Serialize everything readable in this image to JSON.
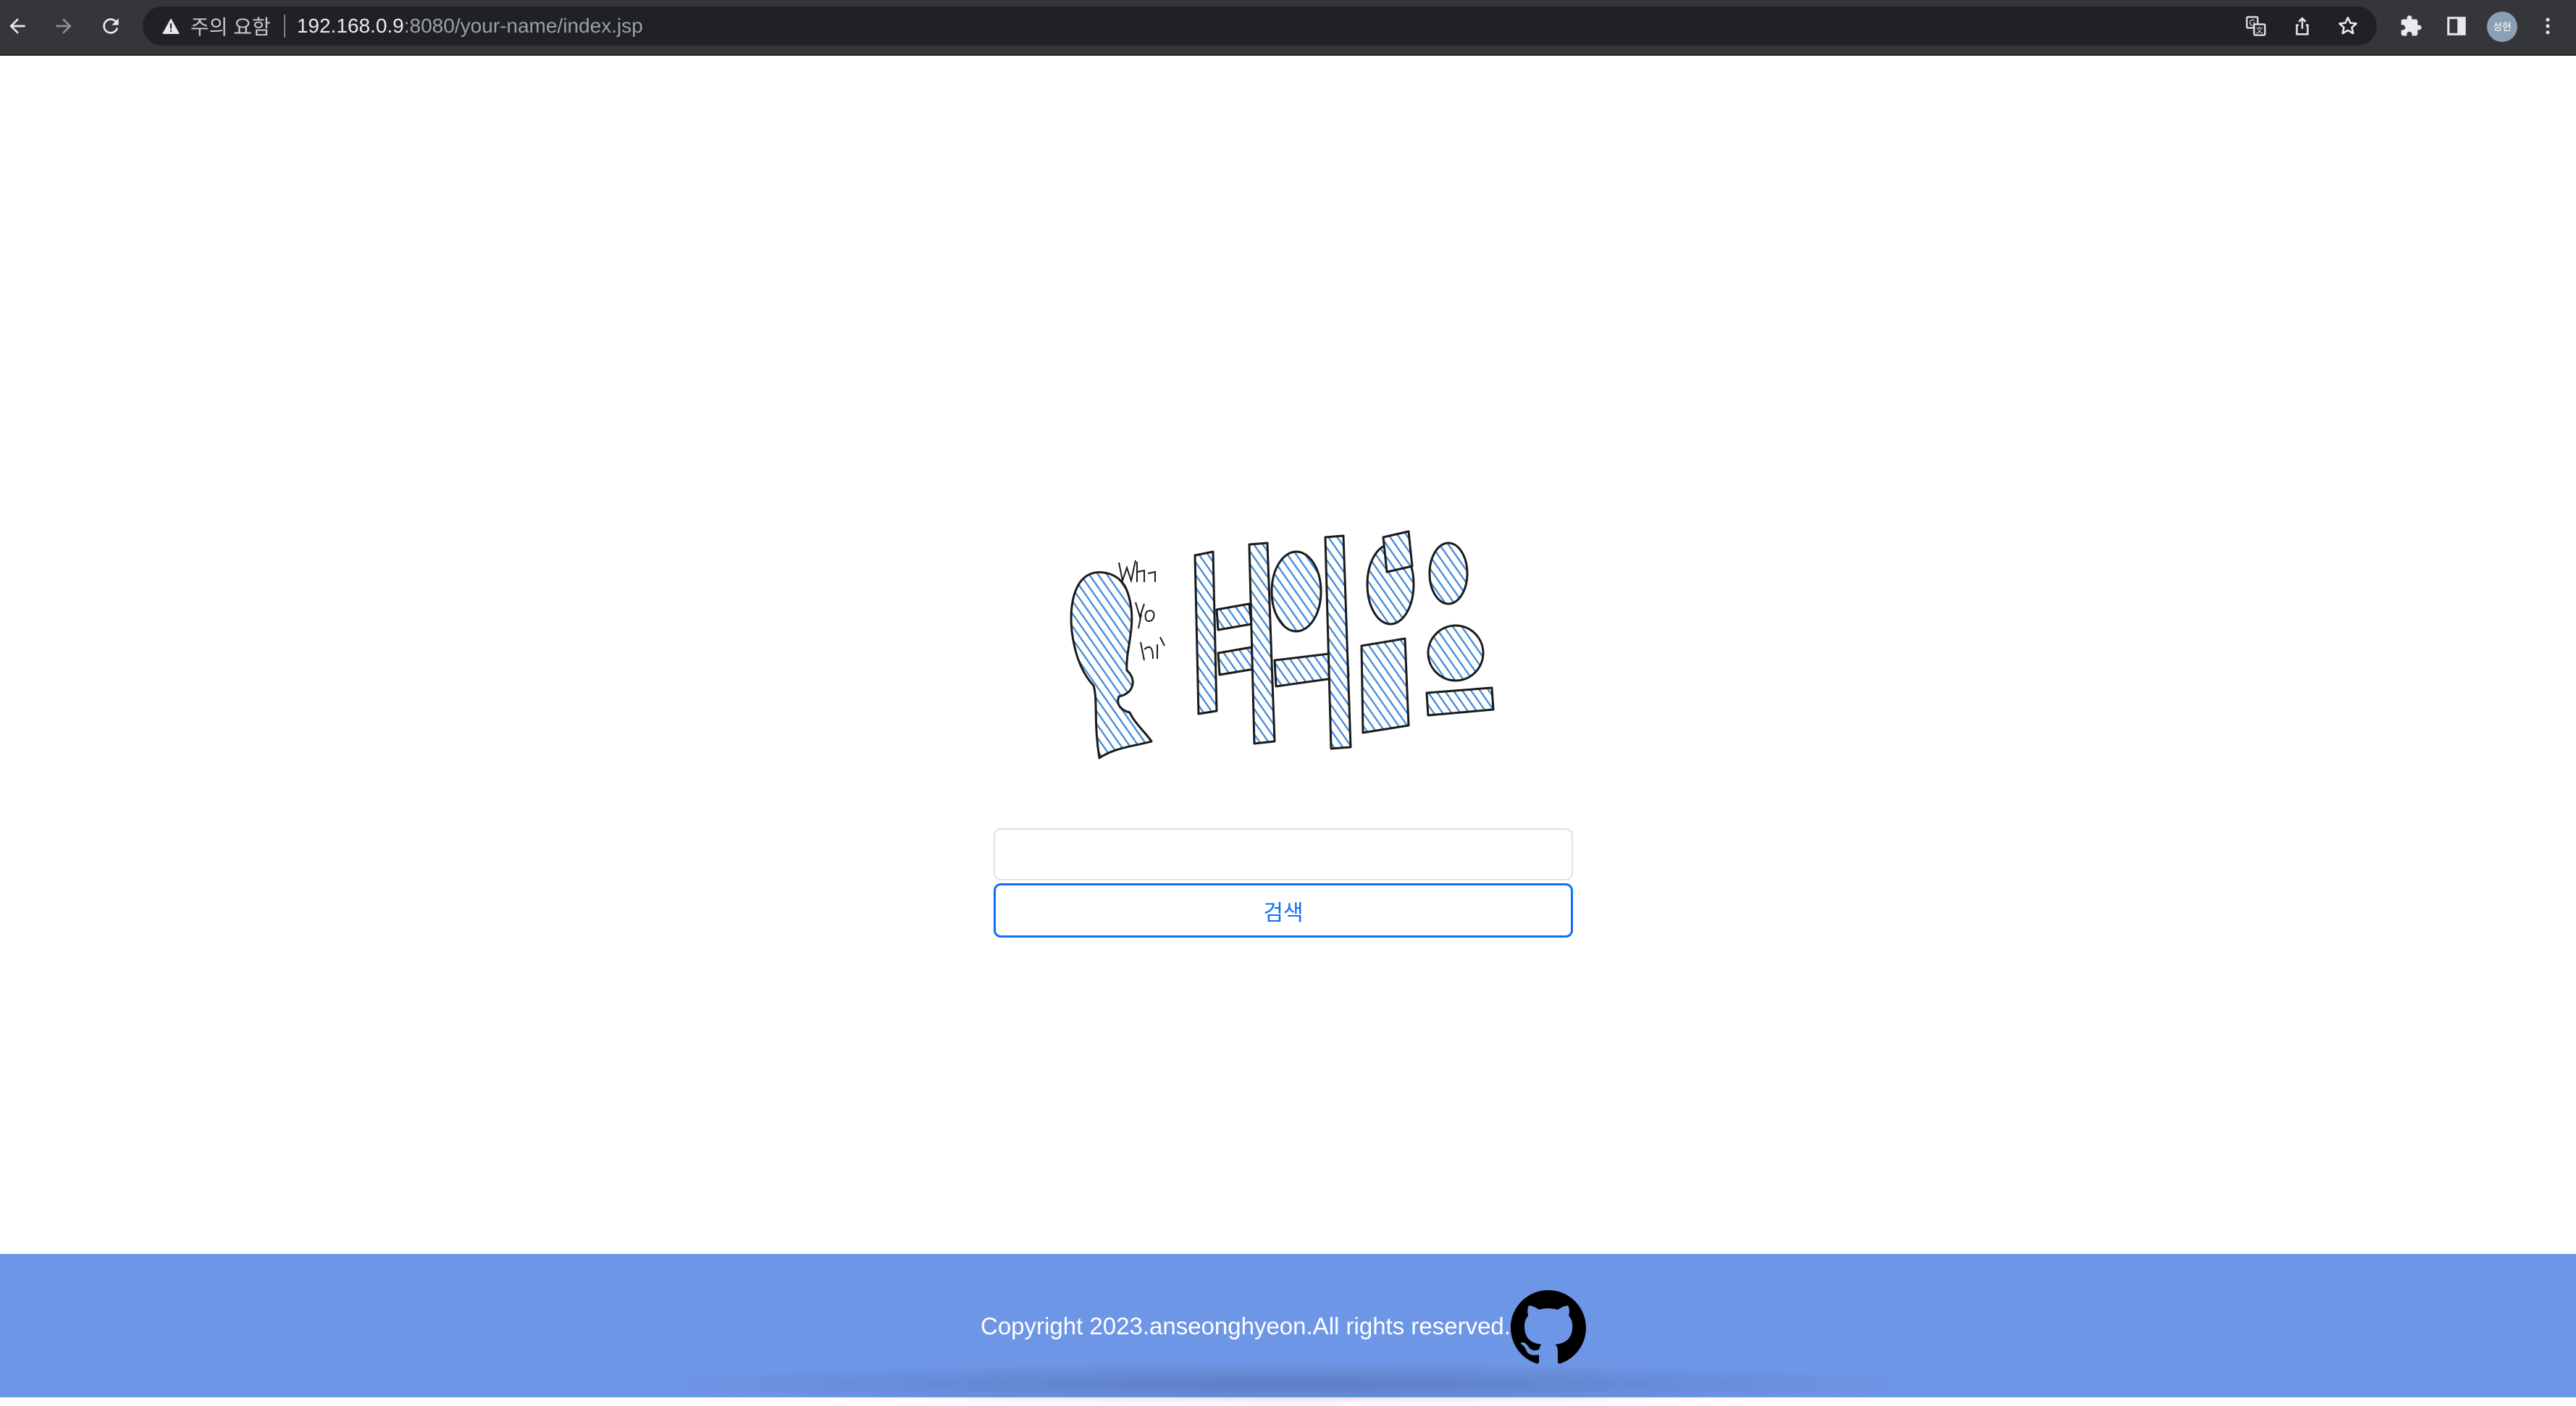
{
  "browser": {
    "security_label": "주의 요함",
    "url_host": "192.168.0.9",
    "url_path": ":8080/your-name/index.jsp",
    "profile_initials": "성현",
    "icons": {
      "back": "arrow-left-icon",
      "forward": "arrow-right-icon",
      "reload": "reload-icon",
      "warning": "warning-icon",
      "translate": "translate-icon",
      "share": "share-icon",
      "bookmark": "star-icon",
      "extensions": "puzzle-icon",
      "side_panel": "side-panel-icon",
      "menu": "more-vertical-icon"
    }
  },
  "page": {
    "logo_text": "너의이름은",
    "logo_scribble": "What your name?",
    "search": {
      "value": "",
      "button_label": "검색"
    }
  },
  "footer": {
    "copyright": "Copyright 2023.anseonghyeon.All rights reserved.",
    "icon": "github-icon",
    "background": "#6e96e6"
  },
  "colors": {
    "accent": "#0d6efd",
    "logo_fill": "#3f87d8",
    "chrome_dark": "#35363a"
  }
}
